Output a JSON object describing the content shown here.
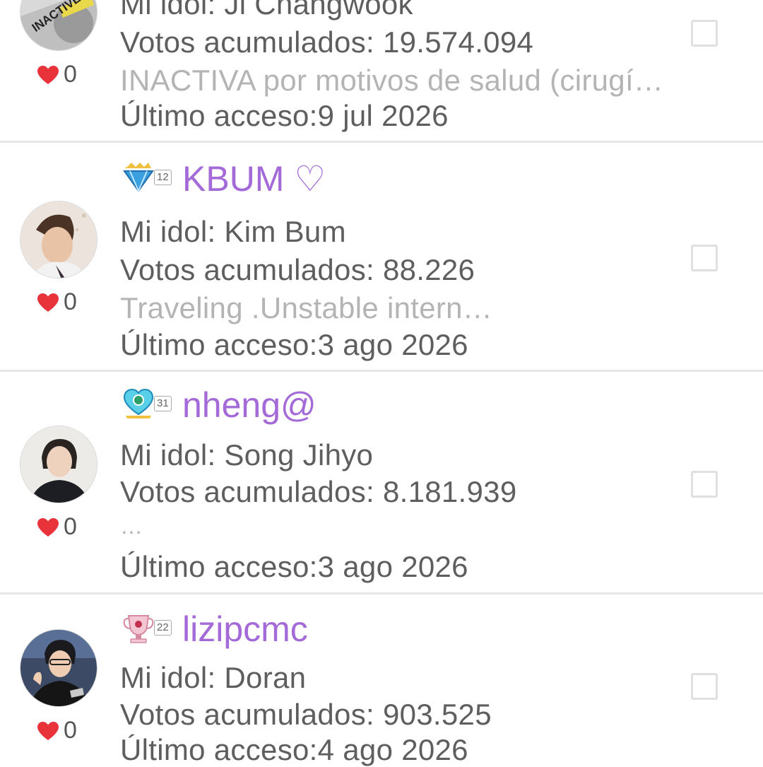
{
  "rows": [
    {
      "idol": "Mi idol: Ji Changwook",
      "votes": "Votos acumulados: 19.574.094",
      "status": "INACTIVA por motivos de salud (cirugí…",
      "last_access": "Último acceso:9 jul 2026",
      "likes": "0",
      "avatar_text": "INACTIVE"
    },
    {
      "level": "12",
      "name": "KBUM ♡",
      "idol": "Mi idol: Kim Bum",
      "votes": "Votos acumulados: 88.226",
      "status": "Traveling .Unstable intern…",
      "last_access": "Último acceso:3 ago 2026",
      "likes": "0"
    },
    {
      "level": "31",
      "name": "nheng@",
      "idol": "Mi idol: Song Jihyo",
      "votes": "Votos acumulados: 8.181.939",
      "status": "…",
      "last_access": "Último acceso:3 ago 2026",
      "likes": "0"
    },
    {
      "level": "22",
      "name": "lizipcmc",
      "idol": "Mi idol: Doran",
      "votes": "Votos acumulados: 903.525",
      "last_access": "Último acceso:4 ago 2026",
      "likes": "0"
    }
  ],
  "colors": {
    "name": "#a36ad8",
    "heart": "#e8333b",
    "status": "#b4b4b4",
    "text": "#5e5e5e",
    "separator": "#e6e6e6"
  }
}
